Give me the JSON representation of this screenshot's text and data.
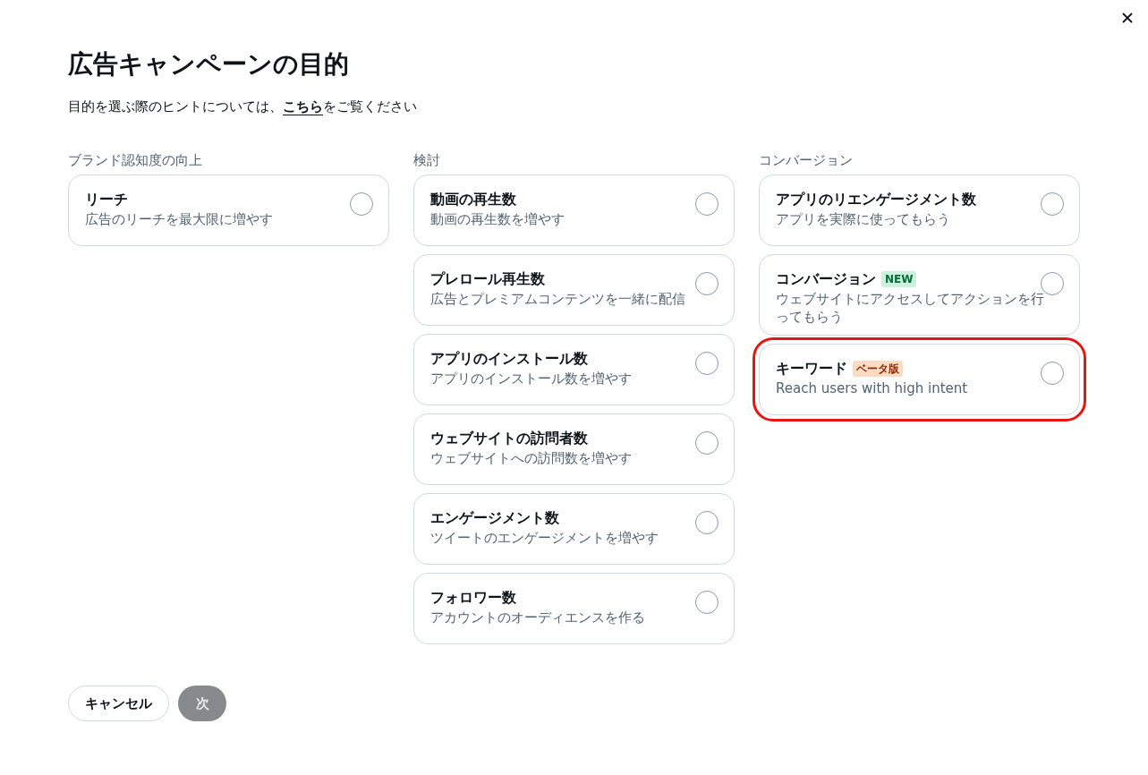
{
  "dialog": {
    "title": "広告キャンペーンの目的",
    "hint": {
      "before": "目的を選ぶ際のヒントについては、",
      "link": "こちら",
      "after": "をご覧ください"
    }
  },
  "groups": [
    {
      "label": "ブランド認知度の向上",
      "options": [
        {
          "title": "リーチ",
          "description": "広告のリーチを最大限に増やす",
          "selected": false,
          "highlighted": false
        }
      ]
    },
    {
      "label": "検討",
      "options": [
        {
          "title": "動画の再生数",
          "description": "動画の再生数を増やす",
          "selected": false,
          "highlighted": false
        },
        {
          "title": "プレロール再生数",
          "description": "広告とプレミアムコンテンツを一緒に配信",
          "selected": false,
          "highlighted": false
        },
        {
          "title": "アプリのインストール数",
          "description": "アプリのインストール数を増やす",
          "selected": false,
          "highlighted": false
        },
        {
          "title": "ウェブサイトの訪問者数",
          "description": "ウェブサイトへの訪問数を増やす",
          "selected": false,
          "highlighted": false
        },
        {
          "title": "エンゲージメント数",
          "description": "ツイートのエンゲージメントを増やす",
          "selected": false,
          "highlighted": false
        },
        {
          "title": "フォロワー数",
          "description": "アカウントのオーディエンスを作る",
          "selected": false,
          "highlighted": false
        }
      ]
    },
    {
      "label": "コンバージョン",
      "options": [
        {
          "title": "アプリのリエンゲージメント数",
          "description": "アプリを実際に使ってもらう",
          "selected": false,
          "highlighted": false
        },
        {
          "title": "コンバージョン",
          "badge": {
            "text": "NEW",
            "kind": "new"
          },
          "description": "ウェブサイトにアクセスしてアクションを行ってもらう",
          "selected": false,
          "highlighted": false
        },
        {
          "title": "キーワード",
          "badge": {
            "text": "ベータ版",
            "kind": "beta"
          },
          "description": "Reach users with high intent",
          "selected": false,
          "highlighted": true
        }
      ]
    }
  ],
  "buttons": [
    {
      "label": "キャンセル",
      "kind": "secondary",
      "disabled": false
    },
    {
      "label": "次",
      "kind": "primary",
      "disabled": true
    }
  ]
}
